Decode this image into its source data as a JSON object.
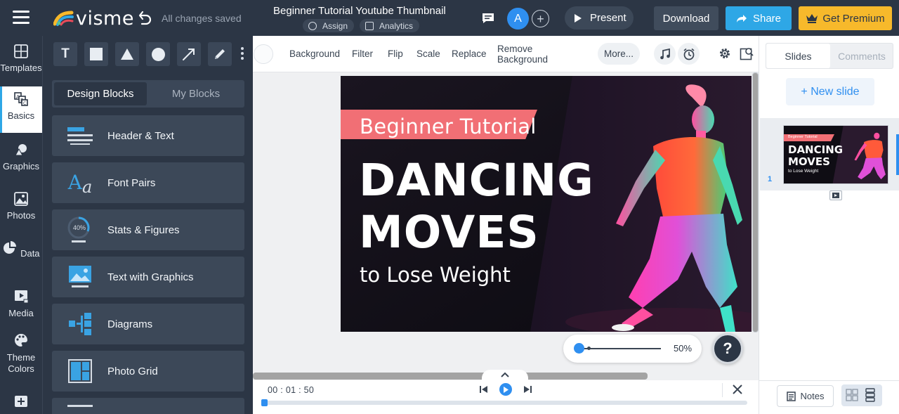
{
  "app": {
    "logo_text": "visme",
    "save_status": "All changes saved",
    "doc_title": "Beginner Tutorial Youtube Thumbnail",
    "assign_label": "Assign",
    "analytics_label": "Analytics",
    "avatar_initial": "A",
    "add_user_glyph": "+",
    "present_label": "Present",
    "download_label": "Download",
    "share_label": "Share",
    "premium_label": "Get Premium",
    "colors": {
      "topbar": "#2c3645",
      "accent_blue": "#2f8ff0",
      "share": "#2ea7e6",
      "premium": "#f7b92b",
      "ribbon": "#f16f75"
    }
  },
  "rail": {
    "items": [
      {
        "label": "Templates",
        "icon": "templates-icon"
      },
      {
        "label": "Basics",
        "icon": "basics-icon",
        "active": true
      },
      {
        "label": "Graphics",
        "icon": "graphics-icon"
      },
      {
        "label": "Photos",
        "icon": "photos-icon"
      },
      {
        "label": "Data",
        "icon": "data-pie-icon"
      },
      {
        "label": "Media",
        "icon": "media-icon"
      },
      {
        "label": "Theme Colors",
        "icon": "palette-icon"
      }
    ]
  },
  "panel": {
    "tools": [
      "text-tool",
      "rectangle-tool",
      "triangle-tool",
      "circle-tool",
      "line-tool",
      "pencil-tool"
    ],
    "text_tool_glyph": "T",
    "tab_design": "Design Blocks",
    "tab_my": "My Blocks",
    "blocks": [
      {
        "label": "Header & Text",
        "icon": "header-text-icon"
      },
      {
        "label": "Font Pairs",
        "icon": "font-pairs-icon"
      },
      {
        "label": "Stats & Figures",
        "icon": "stats-icon",
        "icon_text": "40%"
      },
      {
        "label": "Text with Graphics",
        "icon": "text-graphics-icon"
      },
      {
        "label": "Diagrams",
        "icon": "diagrams-icon"
      },
      {
        "label": "Photo Grid",
        "icon": "photo-grid-icon"
      }
    ]
  },
  "toolbar": {
    "background": "Background",
    "filter": "Filter",
    "flip": "Flip",
    "scale": "Scale",
    "replace": "Replace",
    "remove_line1": "Remove",
    "remove_line2": "Background",
    "more": "More..."
  },
  "slide": {
    "ribbon_text": "Beginner Tutorial",
    "title_line1": "DANCING",
    "title_line2": "MOVES",
    "subtitle": "to Lose Weight"
  },
  "zoom": {
    "value": "50%",
    "level": 0.03
  },
  "help_glyph": "?",
  "timeline": {
    "time_code": "00 : 01 : 50",
    "progress": 0.0
  },
  "right_panel": {
    "tab_slides": "Slides",
    "tab_comments": "Comments",
    "new_slide": "+ New slide",
    "slide_number": "1",
    "notes_label": "Notes"
  }
}
